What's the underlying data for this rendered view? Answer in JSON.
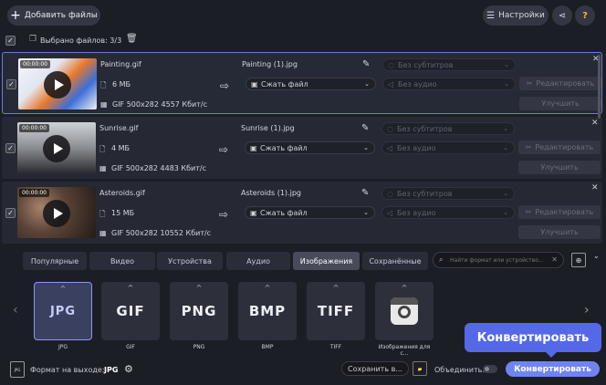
{
  "header": {
    "add_files": "Добавить файлы",
    "settings": "Настройки",
    "help": "?"
  },
  "toolbar": {
    "selected_label": "Выбрано файлов: 3/3"
  },
  "files": [
    {
      "time": "00:00:00",
      "name": "Painting.gif",
      "size": "6 МБ",
      "info": "GIF 500x282 4557 Кбит/с",
      "output": "Painting (1).jpg",
      "compress": "Сжать файл",
      "subs": "Без субтитров",
      "audio": "Без аудио",
      "edit": "Редактировать",
      "enhance": "Улучшить"
    },
    {
      "time": "00:00:00",
      "name": "Sunrise.gif",
      "size": "4 МБ",
      "info": "GIF 500x282 4483 Кбит/с",
      "output": "Sunrise (1).jpg",
      "compress": "Сжать файл",
      "subs": "Без субтитров",
      "audio": "Без аудио",
      "edit": "Редактировать",
      "enhance": "Улучшить"
    },
    {
      "time": "00:00:00",
      "name": "Asteroids.gif",
      "size": "15 МБ",
      "info": "GIF 500x282 10552 Кбит/с",
      "output": "Asteroids (1).jpg",
      "compress": "Сжать файл",
      "subs": "Без субтитров",
      "audio": "Без аудио",
      "edit": "Редактировать",
      "enhance": "Улучшить"
    }
  ],
  "tabs": [
    "Популярные",
    "Видео",
    "Устройства",
    "Аудио",
    "Изображения",
    "Сохранённые"
  ],
  "search": {
    "placeholder": "Найти формат или устройство..."
  },
  "formats": [
    {
      "logo": "JPG",
      "label": "JPG"
    },
    {
      "logo": "GIF",
      "label": "GIF"
    },
    {
      "logo": "PNG",
      "label": "PNG"
    },
    {
      "logo": "BMP",
      "label": "BMP"
    },
    {
      "logo": "TIFF",
      "label": "TIFF"
    },
    {
      "logo": "",
      "label": "Изображения для с..."
    }
  ],
  "footer": {
    "format_label": "Формат на выходе:",
    "format_value": "JPG",
    "format_badge": "JPG",
    "save_to": "Сохранить в...",
    "merge": "Объединить:",
    "convert": "Конвертировать",
    "tooltip": "Конвертировать"
  },
  "colors": {
    "accent": "#7b8cf5",
    "tooltip": "#5468e8",
    "background": "#1c1e26"
  }
}
